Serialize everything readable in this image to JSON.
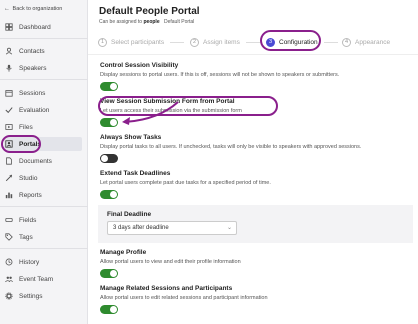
{
  "sidebar": {
    "back_label": "Back to organization",
    "items": [
      {
        "label": "Dashboard",
        "icon": "dashboard-icon"
      },
      {
        "label": "Contacts",
        "icon": "contacts-icon"
      },
      {
        "label": "Speakers",
        "icon": "speakers-icon"
      },
      {
        "label": "Sessions",
        "icon": "sessions-icon"
      },
      {
        "label": "Evaluation",
        "icon": "evaluation-icon"
      },
      {
        "label": "Files",
        "icon": "files-icon"
      },
      {
        "label": "Portals",
        "icon": "portals-icon",
        "active": true
      },
      {
        "label": "Documents",
        "icon": "documents-icon"
      },
      {
        "label": "Studio",
        "icon": "studio-icon"
      },
      {
        "label": "Reports",
        "icon": "reports-icon"
      },
      {
        "label": "Fields",
        "icon": "fields-icon"
      },
      {
        "label": "Tags",
        "icon": "tags-icon"
      },
      {
        "label": "History",
        "icon": "history-icon"
      },
      {
        "label": "Event Team",
        "icon": "event-team-icon"
      },
      {
        "label": "Settings",
        "icon": "settings-icon"
      }
    ]
  },
  "header": {
    "title": "Default People Portal",
    "subtitle_prefix": "Can be assigned to",
    "subtitle_entity": "people",
    "subtitle_tag": "Default Portal"
  },
  "steps": [
    {
      "num": "1",
      "label": "Select participants"
    },
    {
      "num": "2",
      "label": "Assign items"
    },
    {
      "num": "3",
      "label": "Configuration",
      "current": true
    },
    {
      "num": "4",
      "label": "Appearance"
    }
  ],
  "settings": [
    {
      "title": "Control Session Visibility",
      "desc": "Display sessions to portal users. If this is off, sessions will not be shown to speakers or submitters.",
      "on": true
    },
    {
      "title": "View Session Submission Form from Portal",
      "desc": "Let users access their submission via the submission form",
      "on": true
    },
    {
      "title": "Always Show Tasks",
      "desc": "Display portal tasks to all users. If unchecked, tasks will only be visible to speakers with approved sessions.",
      "on": false
    },
    {
      "title": "Extend Task Deadlines",
      "desc": "Let portal users complete past due tasks for a specified period of time.",
      "on": true
    },
    {
      "title": "Manage Profile",
      "desc": "Allow portal users to view and edit their profile information",
      "on": true
    },
    {
      "title": "Manage Related Sessions and Participants",
      "desc": "Allow portal users to edit related sessions and participant information",
      "on": true
    }
  ],
  "final_deadline": {
    "label": "Final Deadline",
    "value": "3 days after deadline"
  },
  "colors": {
    "accent": "#4a4ad4",
    "toggle_on": "#2e8b2e",
    "annotation": "#8a1f8c"
  }
}
